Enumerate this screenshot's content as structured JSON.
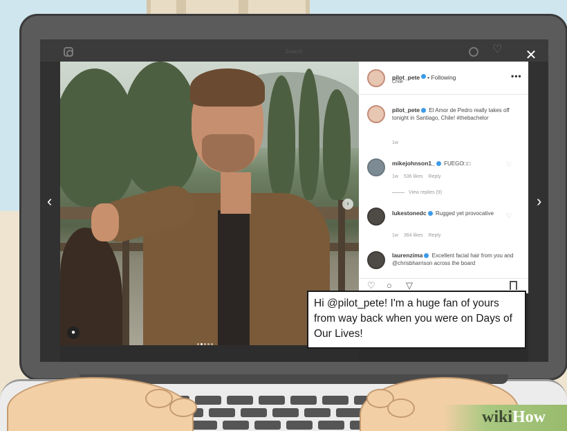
{
  "instagram": {
    "search_placeholder": "Search",
    "post": {
      "author": "pilot_pete",
      "follow_status": "• Following",
      "location": "Chile",
      "more": "•••",
      "caption": "El Amor de Pedro really takes off tonight in Santiago, Chile! #thebachelor",
      "caption_time": "1w"
    },
    "comments": [
      {
        "username": "mikejohnson1_",
        "text": "FUEGO□□",
        "time": "1w",
        "likes": "536 likes",
        "reply": "Reply",
        "view_replies": "View replies (9)"
      },
      {
        "username": "lukestonedc",
        "text": "Rugged yet provocative",
        "time": "1w",
        "likes": "364 likes",
        "reply": "Reply"
      },
      {
        "username": "laurenzima",
        "text": "Excellent facial hair from you and @chrisbharrison across the board"
      }
    ],
    "photo_dots": 5,
    "photo_active_dot": 1
  },
  "message": {
    "text": "Hi @pilot_pete! I'm a huge fan of yours from way back when you were on Days of Our Lives!"
  },
  "watermark": {
    "wiki": "wiki",
    "how": "How"
  },
  "icons": {
    "close": "close-icon",
    "prev": "chevron-left-icon",
    "next": "chevron-right-icon",
    "heart": "heart-icon",
    "comment": "comment-icon",
    "share": "share-icon",
    "bookmark": "bookmark-icon",
    "verified": "verified-icon"
  },
  "colors": {
    "verified": "#3c9ae8",
    "watermark_green": "#98bb6c"
  }
}
